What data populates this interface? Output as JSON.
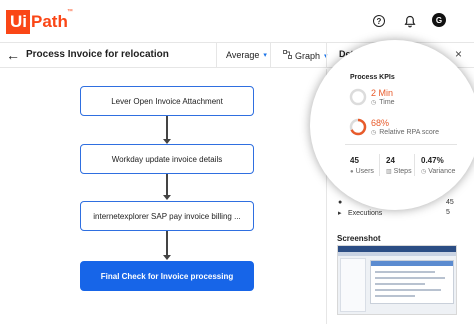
{
  "app": {
    "logo_ui": "Ui",
    "logo_path": "Path",
    "logo_tm": "™",
    "avatar": "G"
  },
  "icons": {
    "back": "←",
    "help": "?",
    "bell": "bell-icon",
    "graph": "graph-icon",
    "caret": "▾",
    "close": "×",
    "time": "◷",
    "score": "◷",
    "users": "●",
    "steps": "▥",
    "variance": "◷",
    "exec": "▸"
  },
  "header": {
    "title": "Process Invoice for relocation",
    "metric_dropdown": "Average",
    "view_dropdown": "Graph",
    "details_label": "Details"
  },
  "flow": {
    "nodes": [
      "Lever Open Invoice Attachment",
      "Workday update invoice details",
      "internetexplorer SAP pay invoice billing ...",
      "Final Check for Invoice processing"
    ]
  },
  "kpis": {
    "title": "Process KPIs",
    "time_value": "2 Min",
    "time_label": "Time",
    "rpa_value": "68%",
    "rpa_percent": 68,
    "rpa_label": "Relative RPA score",
    "users_value": "45",
    "users_label": "Users",
    "steps_value": "24",
    "steps_label": "Steps",
    "variance_value": "0.47%",
    "variance_label": "Variance"
  },
  "panel": {
    "row1_value": "45",
    "executions_label": "Executions",
    "executions_value": "5",
    "screenshot_title": "Screenshot"
  },
  "colors": {
    "brand": "#fa4616",
    "accent": "#1765e8",
    "kpi": "#e85b2b"
  }
}
